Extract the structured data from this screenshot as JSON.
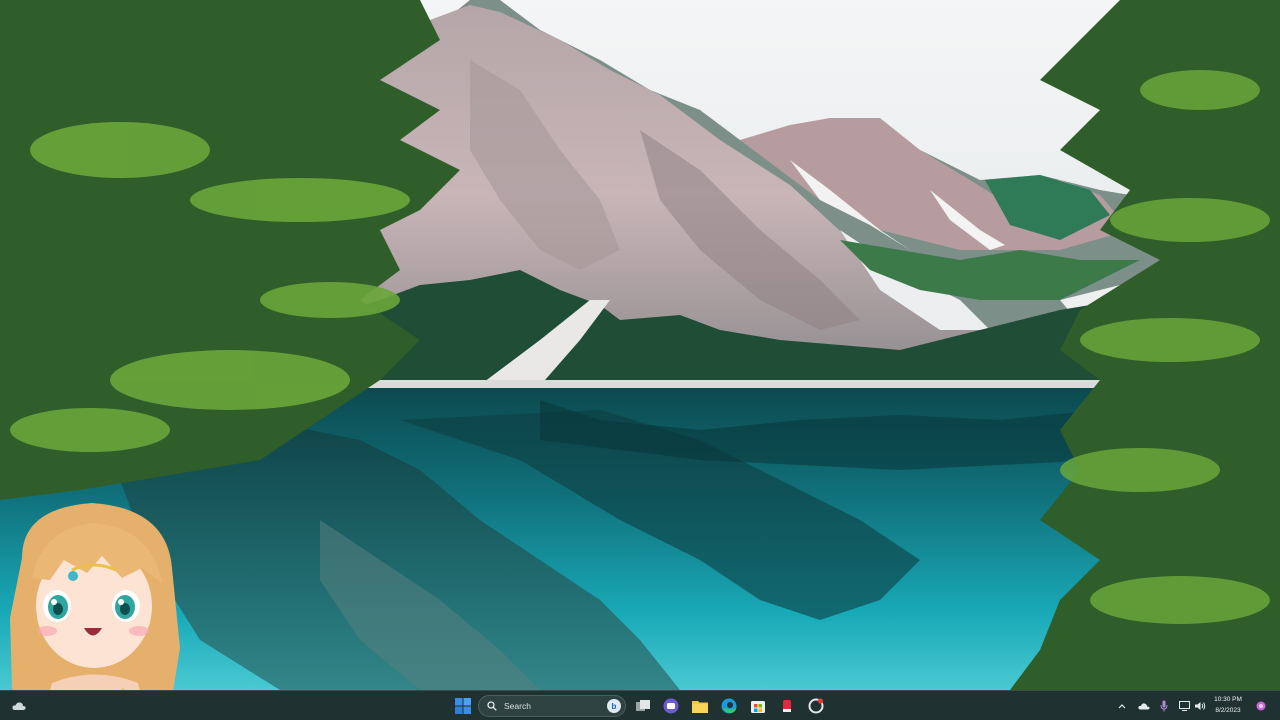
{
  "taskbar": {
    "search": {
      "label": "Search"
    },
    "pinned": [
      {
        "name": "start-button",
        "icon": "windows-logo-icon"
      },
      {
        "name": "task-view-button",
        "icon": "task-view-icon"
      },
      {
        "name": "chat-button",
        "icon": "chat-icon"
      },
      {
        "name": "file-explorer-button",
        "icon": "folder-icon"
      },
      {
        "name": "edge-button",
        "icon": "edge-icon"
      },
      {
        "name": "store-button",
        "icon": "store-icon"
      },
      {
        "name": "app-red-button",
        "icon": "red-app-icon"
      },
      {
        "name": "app-circle-button",
        "icon": "circle-app-icon"
      }
    ],
    "clock": {
      "time": "10:30 PM",
      "date": "8/2/2023"
    },
    "colors": {
      "taskbar_bg": "#1f3231",
      "accent": "#3a8ee6"
    }
  },
  "desktop": {
    "wallpaper": "mountain-lake-wallpaper",
    "overlay": "anime-avatar-streamer"
  }
}
